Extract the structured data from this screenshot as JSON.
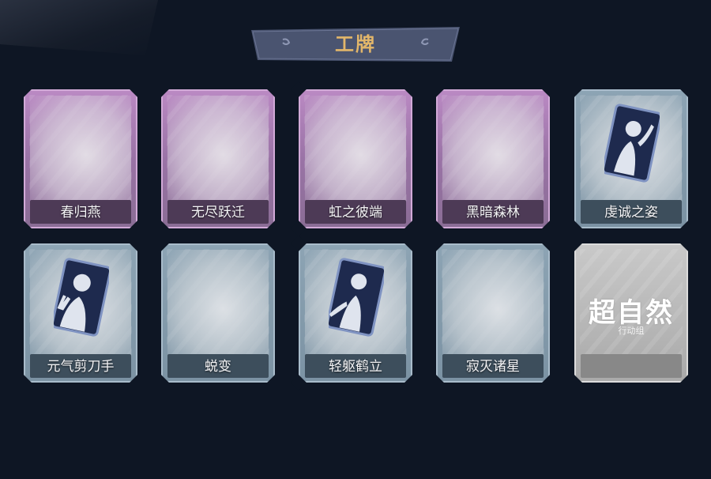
{
  "header": {
    "title": "工牌"
  },
  "cards": [
    {
      "label": "春归燕",
      "style": "purple",
      "portrait": false
    },
    {
      "label": "无尽跃迁",
      "style": "purple",
      "portrait": false
    },
    {
      "label": "虹之彼端",
      "style": "purple",
      "portrait": false
    },
    {
      "label": "黑暗森林",
      "style": "purple",
      "portrait": false
    },
    {
      "label": "虔诚之姿",
      "style": "blue",
      "portrait": true,
      "pose": "arm-raised"
    },
    {
      "label": "元气剪刀手",
      "style": "blue",
      "portrait": true,
      "pose": "peace-sign"
    },
    {
      "label": "蜕变",
      "style": "blue",
      "portrait": false
    },
    {
      "label": "轻躯鹤立",
      "style": "blue",
      "portrait": true,
      "pose": "arm-out"
    },
    {
      "label": "寂灭诸星",
      "style": "blue",
      "portrait": false
    },
    {
      "label": "",
      "style": "gray",
      "logo": "超自然",
      "logo_sub": "行动组"
    }
  ],
  "colors": {
    "background": "#0e1624",
    "title_gold": "#e2b66a",
    "banner": "#4a5470"
  }
}
